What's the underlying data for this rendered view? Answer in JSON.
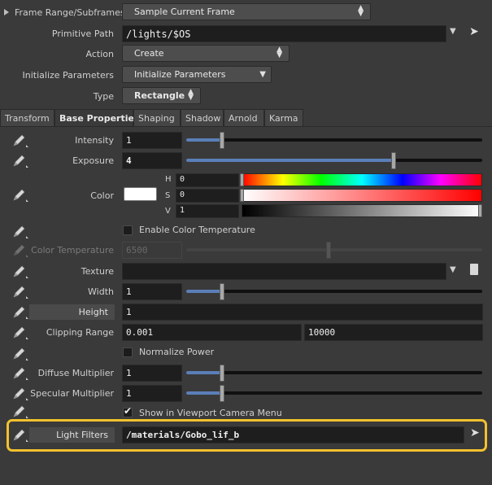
{
  "rows": {
    "frame_range": {
      "label": "Frame Range/Subframes",
      "value": "Sample Current Frame"
    },
    "primitive_path": {
      "label": "Primitive Path",
      "value": "/lights/$OS"
    },
    "action": {
      "label": "Action",
      "value": "Create"
    },
    "init_params": {
      "label": "Initialize Parameters",
      "value": "Initialize Parameters"
    },
    "type": {
      "label": "Type",
      "value": "Rectangle"
    }
  },
  "tabs": [
    "Transform",
    "Base Properties",
    "Shaping",
    "Shadow",
    "Arnold",
    "Karma"
  ],
  "active_tab": "Base Properties",
  "params": {
    "intensity": {
      "label": "Intensity",
      "value": "1",
      "slider": 0.12
    },
    "exposure": {
      "label": "Exposure",
      "value": "4",
      "slider": 0.7
    },
    "color": {
      "label": "Color",
      "h_label": "H",
      "s_label": "S",
      "v_label": "V",
      "h": "0",
      "s": "0",
      "v": "1",
      "swatch": "#ffffff"
    },
    "enable_color_temp": {
      "label": "Enable Color Temperature",
      "checked": false
    },
    "color_temp": {
      "label": "Color Temperature",
      "value": "6500",
      "slider": 0.48
    },
    "texture": {
      "label": "Texture",
      "value": ""
    },
    "width": {
      "label": "Width",
      "value": "1",
      "slider": 0.12
    },
    "height": {
      "label": "Height",
      "value": "1"
    },
    "clipping": {
      "label": "Clipping Range",
      "near": "0.001",
      "far": "10000"
    },
    "normalize": {
      "label": "Normalize Power",
      "checked": false
    },
    "diffuse": {
      "label": "Diffuse Multiplier",
      "value": "1",
      "slider": 0.12
    },
    "specular": {
      "label": "Specular Multiplier",
      "value": "1",
      "slider": 0.12
    },
    "viewport_menu": {
      "label": "Show in Viewport Camera Menu",
      "checked": true
    },
    "light_filters": {
      "label": "Light Filters",
      "value": "/materials/Gobo_lif_b"
    }
  },
  "colors": {
    "highlight": "#f2c12e",
    "slider_fill": "#5b7fb8"
  }
}
